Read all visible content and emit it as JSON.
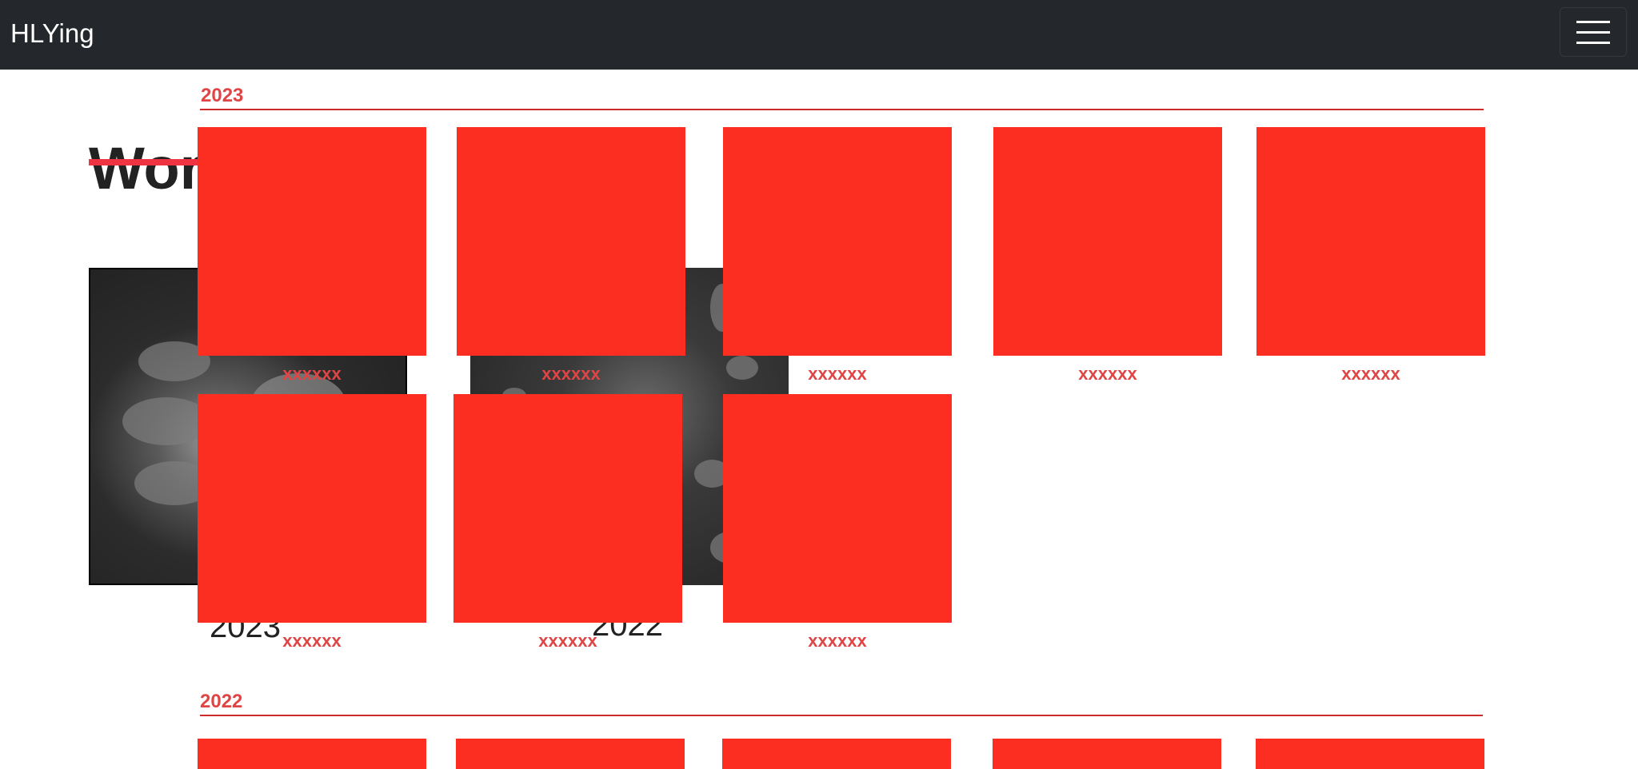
{
  "navbar": {
    "brand": "HLYing",
    "menu_icon": "hamburger-menu-icon"
  },
  "background_section": {
    "title": "Work",
    "items": [
      {
        "year": "2023"
      },
      {
        "year": "2022"
      }
    ]
  },
  "years": [
    {
      "label": "2023",
      "works": [
        {
          "caption": "xxxxxx"
        },
        {
          "caption": "xxxxxx"
        },
        {
          "caption": "xxxxxx"
        },
        {
          "caption": "xxxxxx"
        },
        {
          "caption": "xxxxxx"
        },
        {
          "caption": "xxxxxx"
        },
        {
          "caption": "xxxxxx"
        },
        {
          "caption": "xxxxxx"
        }
      ]
    },
    {
      "label": "2022",
      "works": [
        {
          "caption": ""
        },
        {
          "caption": ""
        },
        {
          "caption": ""
        },
        {
          "caption": ""
        },
        {
          "caption": ""
        }
      ]
    }
  ],
  "colors": {
    "navbar_bg": "#24272b",
    "accent": "#e04545",
    "thumb": "#fc2d21"
  }
}
